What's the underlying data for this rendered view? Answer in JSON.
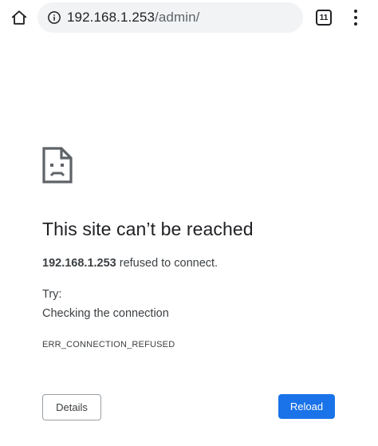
{
  "toolbar": {
    "home_icon": "home-icon",
    "info_icon": "info-icon",
    "url_host": "192.168.1.253",
    "url_path": "/admin/",
    "tab_count": "11",
    "menu_icon": "more-vert-icon"
  },
  "error": {
    "icon": "sad-document-icon",
    "headline": "This site can’t be reached",
    "host": "192.168.1.253",
    "summary_rest": " refused to connect.",
    "try_label": "Try:",
    "suggestion": "Checking the connection",
    "code": "ERR_CONNECTION_REFUSED"
  },
  "buttons": {
    "details": "Details",
    "reload": "Reload"
  },
  "colors": {
    "accent": "#1a73e8",
    "text": "#202124",
    "secondary_text": "#3c4043",
    "omnibox_bg": "#f1f3f4"
  }
}
